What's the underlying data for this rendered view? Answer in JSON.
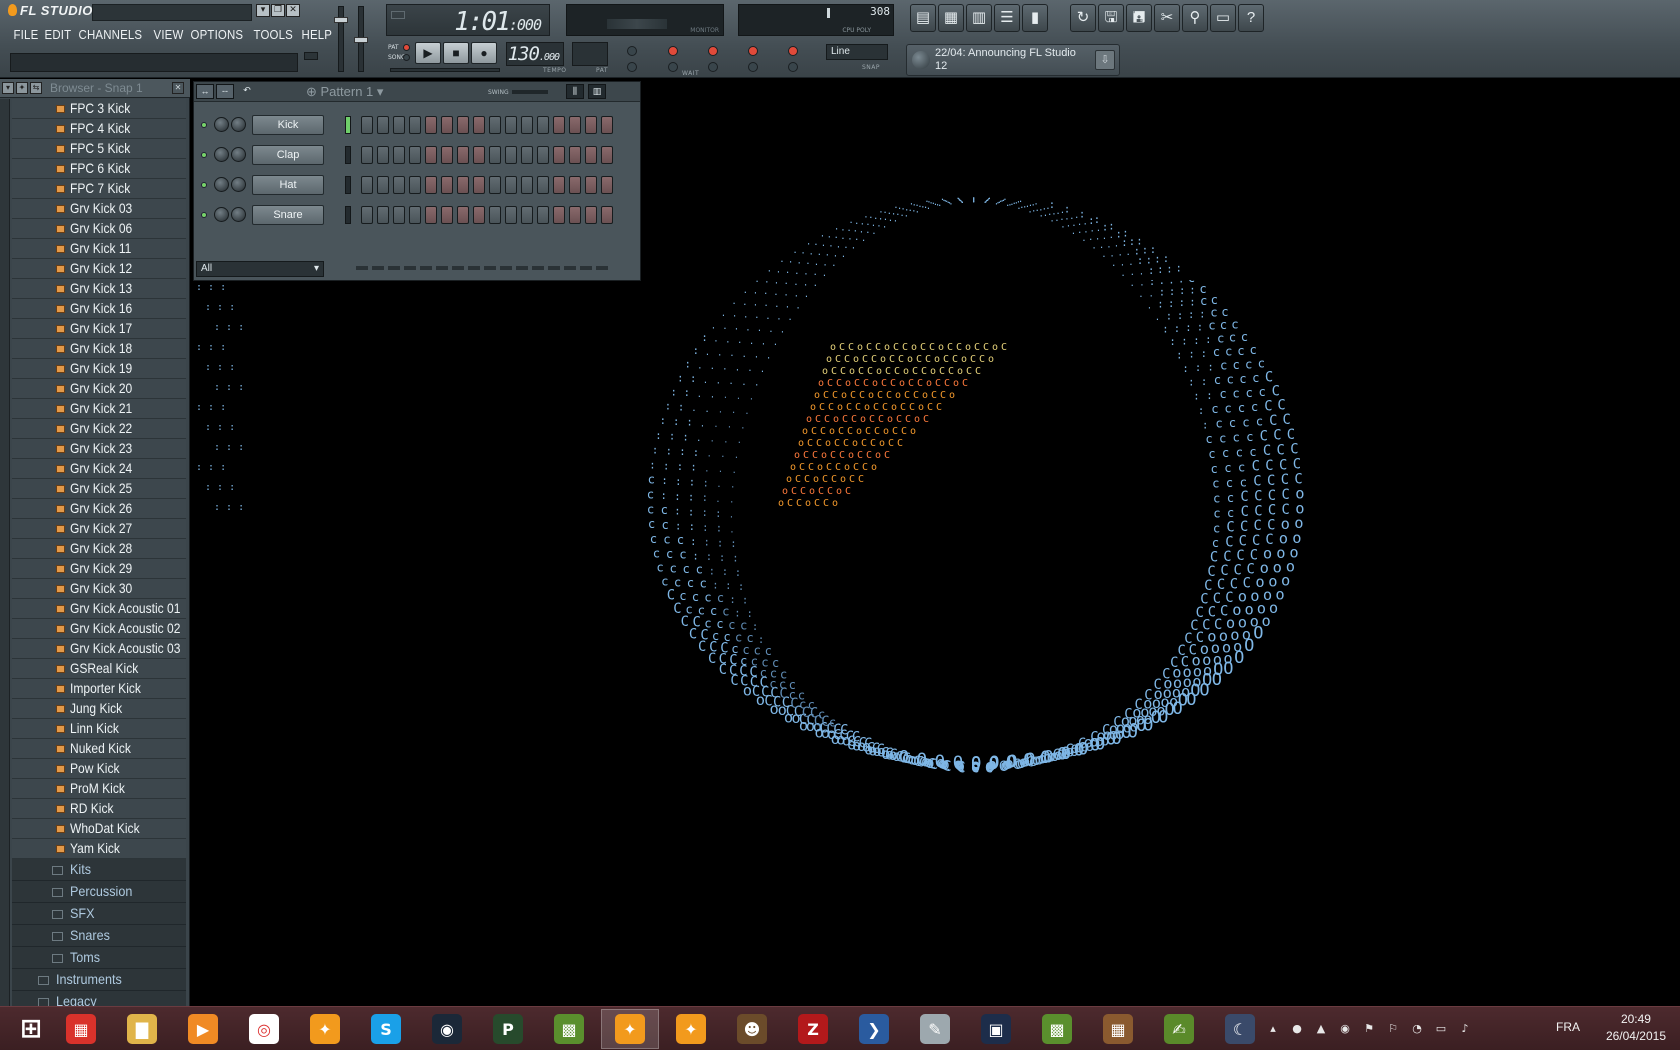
{
  "app": {
    "logo_text": "FL STUDIO",
    "menu": [
      "FILE",
      "EDIT",
      "CHANNELS",
      "VIEW",
      "OPTIONS",
      "TOOLS",
      "HELP"
    ]
  },
  "transport": {
    "song_time_main": "1:01",
    "song_time_ticks": ":000",
    "tempo_main": "130",
    "tempo_decimal": ".000",
    "tempo_label": "TEMPO",
    "pat_label": "PAT",
    "pat_mode": "PAT",
    "song_mode": "SONG",
    "monitor_label": "MONITOR",
    "cpu_value": "308",
    "cpu_label": "CPU  POLY",
    "snap_value": "Line",
    "snap_label": "SNAP",
    "wait_label": "WAIT",
    "news_text": "22/04: Announcing FL Studio 12"
  },
  "browser": {
    "title": "Browser - Snap 1",
    "files": [
      "FPC 3 Kick",
      "FPC 4 Kick",
      "FPC 5 Kick",
      "FPC 6 Kick",
      "FPC 7 Kick",
      "Grv Kick 03",
      "Grv Kick 06",
      "Grv Kick 11",
      "Grv Kick 12",
      "Grv Kick 13",
      "Grv Kick 16",
      "Grv Kick 17",
      "Grv Kick 18",
      "Grv Kick 19",
      "Grv Kick 20",
      "Grv Kick 21",
      "Grv Kick 22",
      "Grv Kick 23",
      "Grv Kick 24",
      "Grv Kick 25",
      "Grv Kick 26",
      "Grv Kick 27",
      "Grv Kick 28",
      "Grv Kick 29",
      "Grv Kick 30",
      "Grv Kick Acoustic 01",
      "Grv Kick Acoustic 02",
      "Grv Kick Acoustic 03",
      "GSReal Kick",
      "Importer Kick",
      "Jung Kick",
      "Linn Kick",
      "Nuked Kick",
      "Pow Kick",
      "ProM Kick",
      "RD Kick",
      "WhoDat Kick",
      "Yam Kick"
    ],
    "subfolders": [
      "Kits",
      "Percussion",
      "SFX",
      "Snares",
      "Toms"
    ],
    "top_folders": [
      "Instruments",
      "Legacy"
    ]
  },
  "channel_rack": {
    "pattern_label": "Pattern 1",
    "swing_label": "SWING",
    "filter_value": "All",
    "channels": [
      "Kick",
      "Clap",
      "Hat",
      "Snare"
    ]
  },
  "colors": {
    "toolbar": "#4c575d",
    "browser_bg": "#3b454b",
    "folder_text": "#aec9df",
    "taskbar": "#3b1f22",
    "accent_orange": "#f29a1d",
    "viz_blue": "#7fb7e6",
    "viz_orange": "#f59a2c"
  },
  "taskbar": {
    "icons": [
      "windows-start-icon",
      "metro-apps-icon",
      "file-explorer-icon",
      "media-player-icon",
      "chrome-icon",
      "fl-studio-icon",
      "skype-icon",
      "steam-icon",
      "ptb-icon",
      "minecraft-icon",
      "fl-studio-active-icon",
      "fl-studio-icon-2",
      "character-app-icon",
      "filezilla-icon",
      "powershell-icon",
      "paint-icon",
      "terminal-icon",
      "minecraft-icon-2",
      "crafting-table-icon",
      "editor-icon",
      "moon-app-icon"
    ],
    "language": "FRA",
    "time": "20:49",
    "date": "26/04/2015"
  }
}
